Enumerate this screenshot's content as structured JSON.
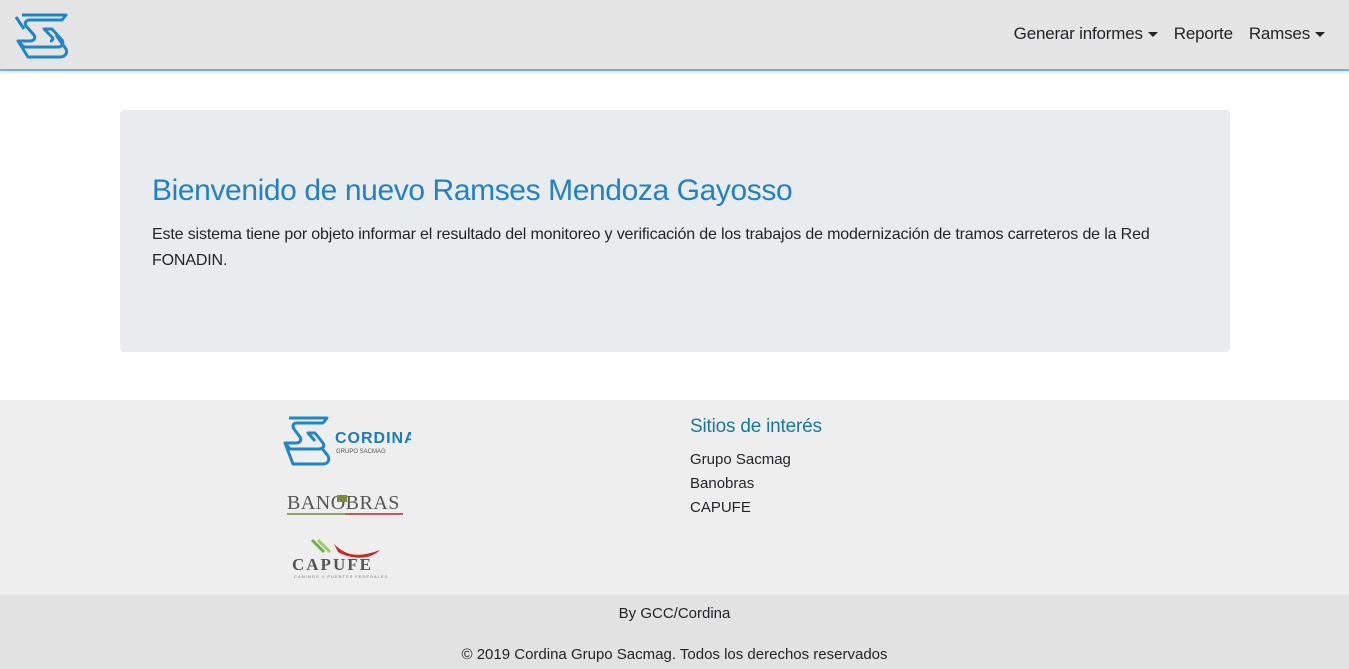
{
  "navbar": {
    "brand_icon": "grupo-sacmag-logo",
    "items": [
      {
        "label": "Generar informes",
        "dropdown": true
      },
      {
        "label": "Reporte",
        "dropdown": false
      },
      {
        "label": "Ramses",
        "dropdown": true
      }
    ]
  },
  "jumbotron": {
    "title": "Bienvenido de nuevo Ramses Mendoza Gayosso",
    "text": "Este sistema tiene por objeto informar el resultado del monitoreo y verificación de los trabajos de modernización de tramos carreteros de la Red FONADIN."
  },
  "footer": {
    "logos": {
      "cordina_name": "CORDINA",
      "cordina_sub": "GRUPO SACMAG",
      "banobras": "BANOBRAS",
      "capufe": "CAPUFE",
      "capufe_sub": "CAMINOS Y PUENTES FEDERALES"
    },
    "sitios_title": "Sitios de interés",
    "links": [
      "Grupo Sacmag",
      "Banobras",
      "CAPUFE"
    ],
    "by": "By GCC/Cordina",
    "copyright": "© 2019 Cordina Grupo Sacmag. Todos los derechos reservados"
  },
  "colors": {
    "accent": "#2381c1",
    "navbar_bg": "#e5e5e5",
    "navbar_border": "#6fb2e6",
    "jumbotron_bg": "#e9ecef",
    "footer_bg": "#eeeeee"
  }
}
